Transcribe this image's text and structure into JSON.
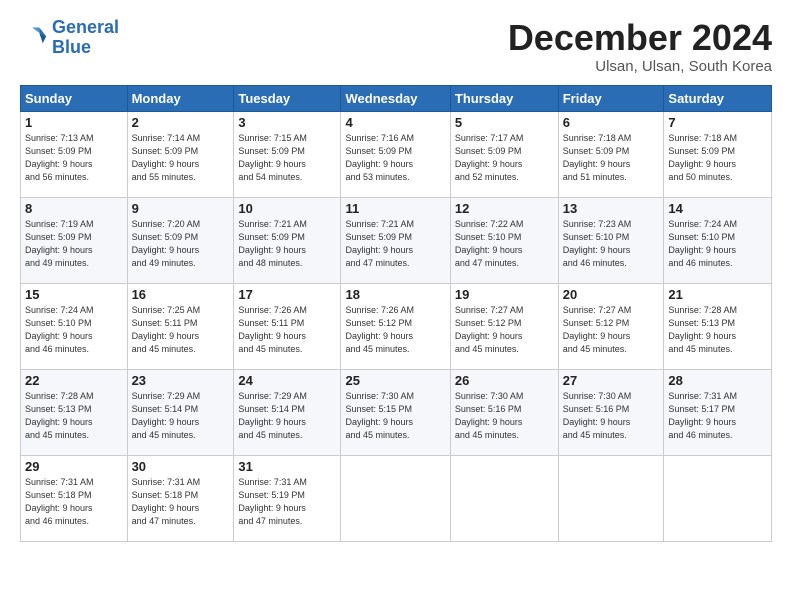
{
  "logo": {
    "line1": "General",
    "line2": "Blue"
  },
  "header": {
    "month": "December 2024",
    "location": "Ulsan, Ulsan, South Korea"
  },
  "weekdays": [
    "Sunday",
    "Monday",
    "Tuesday",
    "Wednesday",
    "Thursday",
    "Friday",
    "Saturday"
  ],
  "weeks": [
    [
      {
        "day": "1",
        "info": "Sunrise: 7:13 AM\nSunset: 5:09 PM\nDaylight: 9 hours\nand 56 minutes."
      },
      {
        "day": "2",
        "info": "Sunrise: 7:14 AM\nSunset: 5:09 PM\nDaylight: 9 hours\nand 55 minutes."
      },
      {
        "day": "3",
        "info": "Sunrise: 7:15 AM\nSunset: 5:09 PM\nDaylight: 9 hours\nand 54 minutes."
      },
      {
        "day": "4",
        "info": "Sunrise: 7:16 AM\nSunset: 5:09 PM\nDaylight: 9 hours\nand 53 minutes."
      },
      {
        "day": "5",
        "info": "Sunrise: 7:17 AM\nSunset: 5:09 PM\nDaylight: 9 hours\nand 52 minutes."
      },
      {
        "day": "6",
        "info": "Sunrise: 7:18 AM\nSunset: 5:09 PM\nDaylight: 9 hours\nand 51 minutes."
      },
      {
        "day": "7",
        "info": "Sunrise: 7:18 AM\nSunset: 5:09 PM\nDaylight: 9 hours\nand 50 minutes."
      }
    ],
    [
      {
        "day": "8",
        "info": "Sunrise: 7:19 AM\nSunset: 5:09 PM\nDaylight: 9 hours\nand 49 minutes."
      },
      {
        "day": "9",
        "info": "Sunrise: 7:20 AM\nSunset: 5:09 PM\nDaylight: 9 hours\nand 49 minutes."
      },
      {
        "day": "10",
        "info": "Sunrise: 7:21 AM\nSunset: 5:09 PM\nDaylight: 9 hours\nand 48 minutes."
      },
      {
        "day": "11",
        "info": "Sunrise: 7:21 AM\nSunset: 5:09 PM\nDaylight: 9 hours\nand 47 minutes."
      },
      {
        "day": "12",
        "info": "Sunrise: 7:22 AM\nSunset: 5:10 PM\nDaylight: 9 hours\nand 47 minutes."
      },
      {
        "day": "13",
        "info": "Sunrise: 7:23 AM\nSunset: 5:10 PM\nDaylight: 9 hours\nand 46 minutes."
      },
      {
        "day": "14",
        "info": "Sunrise: 7:24 AM\nSunset: 5:10 PM\nDaylight: 9 hours\nand 46 minutes."
      }
    ],
    [
      {
        "day": "15",
        "info": "Sunrise: 7:24 AM\nSunset: 5:10 PM\nDaylight: 9 hours\nand 46 minutes."
      },
      {
        "day": "16",
        "info": "Sunrise: 7:25 AM\nSunset: 5:11 PM\nDaylight: 9 hours\nand 45 minutes."
      },
      {
        "day": "17",
        "info": "Sunrise: 7:26 AM\nSunset: 5:11 PM\nDaylight: 9 hours\nand 45 minutes."
      },
      {
        "day": "18",
        "info": "Sunrise: 7:26 AM\nSunset: 5:12 PM\nDaylight: 9 hours\nand 45 minutes."
      },
      {
        "day": "19",
        "info": "Sunrise: 7:27 AM\nSunset: 5:12 PM\nDaylight: 9 hours\nand 45 minutes."
      },
      {
        "day": "20",
        "info": "Sunrise: 7:27 AM\nSunset: 5:12 PM\nDaylight: 9 hours\nand 45 minutes."
      },
      {
        "day": "21",
        "info": "Sunrise: 7:28 AM\nSunset: 5:13 PM\nDaylight: 9 hours\nand 45 minutes."
      }
    ],
    [
      {
        "day": "22",
        "info": "Sunrise: 7:28 AM\nSunset: 5:13 PM\nDaylight: 9 hours\nand 45 minutes."
      },
      {
        "day": "23",
        "info": "Sunrise: 7:29 AM\nSunset: 5:14 PM\nDaylight: 9 hours\nand 45 minutes."
      },
      {
        "day": "24",
        "info": "Sunrise: 7:29 AM\nSunset: 5:14 PM\nDaylight: 9 hours\nand 45 minutes."
      },
      {
        "day": "25",
        "info": "Sunrise: 7:30 AM\nSunset: 5:15 PM\nDaylight: 9 hours\nand 45 minutes."
      },
      {
        "day": "26",
        "info": "Sunrise: 7:30 AM\nSunset: 5:16 PM\nDaylight: 9 hours\nand 45 minutes."
      },
      {
        "day": "27",
        "info": "Sunrise: 7:30 AM\nSunset: 5:16 PM\nDaylight: 9 hours\nand 45 minutes."
      },
      {
        "day": "28",
        "info": "Sunrise: 7:31 AM\nSunset: 5:17 PM\nDaylight: 9 hours\nand 46 minutes."
      }
    ],
    [
      {
        "day": "29",
        "info": "Sunrise: 7:31 AM\nSunset: 5:18 PM\nDaylight: 9 hours\nand 46 minutes."
      },
      {
        "day": "30",
        "info": "Sunrise: 7:31 AM\nSunset: 5:18 PM\nDaylight: 9 hours\nand 47 minutes."
      },
      {
        "day": "31",
        "info": "Sunrise: 7:31 AM\nSunset: 5:19 PM\nDaylight: 9 hours\nand 47 minutes."
      },
      null,
      null,
      null,
      null
    ]
  ]
}
